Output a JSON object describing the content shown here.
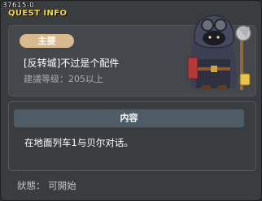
{
  "window": {
    "quest_id": "37615-0",
    "title": "QUEST INFO"
  },
  "summary": {
    "type_badge": "主要",
    "quest_name": "[反转城]不过是个配件",
    "level_requirement": "建議等级：205以上",
    "npc_portrait_icon": "hooded-steampunk-npc"
  },
  "content": {
    "header": "内容",
    "text": "在地面列车1与贝尔对话。"
  },
  "status": {
    "text": "狀態： 可開始"
  },
  "colors": {
    "title_yellow": "#f4d24a",
    "badge_tan": "#d9b98e",
    "content_header": "#4f5c66",
    "window_bg": "#3a3d40"
  }
}
